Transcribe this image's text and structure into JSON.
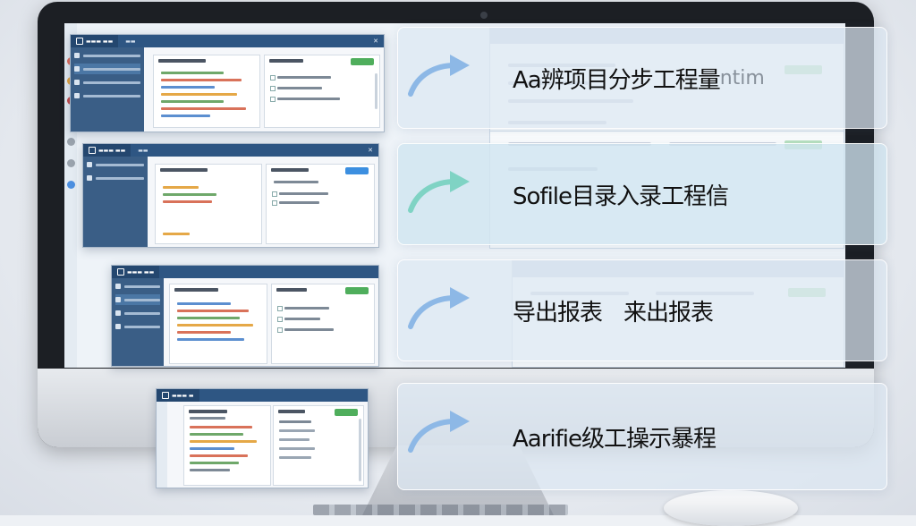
{
  "steps": [
    {
      "label": "Aa辨项目分步工程量",
      "suffix": "ntim"
    },
    {
      "label": "Sofile目录入录工程信"
    },
    {
      "label": "导出报表",
      "label2": "来出报表"
    },
    {
      "label": "Aarifie级工操示暴程"
    }
  ],
  "colors": {
    "window_bar": "#2e5683",
    "sidebar": "#3a5e86",
    "arrow_blue": "#8db8e6",
    "arrow_teal": "#7fd3c4",
    "primary_button": "#4fae5c",
    "blue_button": "#3c8fe0"
  },
  "icons": [
    "app-icon",
    "menu-icon",
    "arrow-right-icon",
    "window-close-icon",
    "dock-dot-icon"
  ]
}
